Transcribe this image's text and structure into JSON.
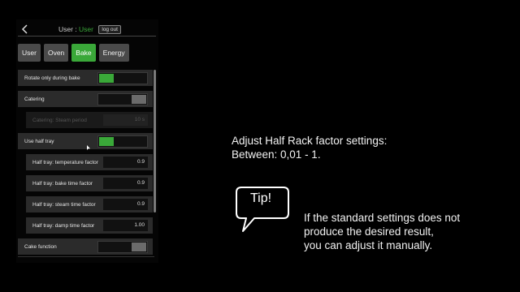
{
  "header": {
    "user_label": "User :",
    "user_name": "User",
    "logout_label": "log out"
  },
  "tabs": [
    {
      "label": "User",
      "active": false
    },
    {
      "label": "Oven",
      "active": false
    },
    {
      "label": "Bake",
      "active": true
    },
    {
      "label": "Energy",
      "active": false
    }
  ],
  "settings": [
    {
      "label": "Rotate only during bake",
      "type": "toggle",
      "state": "on"
    },
    {
      "label": "Catering",
      "type": "toggle",
      "state": "off"
    },
    {
      "label": "Catering: Steam period",
      "type": "value",
      "value": "10 s",
      "disabled": true
    },
    {
      "label": "Use half tray",
      "type": "toggle",
      "state": "on"
    },
    {
      "label": "Half tray: temperature factor",
      "type": "value",
      "value": "0.9"
    },
    {
      "label": "Half tray: bake time factor",
      "type": "value",
      "value": "0.9"
    },
    {
      "label": "Half tray: steam time factor",
      "type": "value",
      "value": "0.9"
    },
    {
      "label": "Half tray: damp time factor",
      "type": "value",
      "value": "1.00"
    },
    {
      "label": "Cake function",
      "type": "toggle",
      "state": "off"
    }
  ],
  "instructions": {
    "line1": "Adjust Half Rack factor settings:",
    "line2": "Between: 0,01 - 1."
  },
  "tip": {
    "label": "Tip!",
    "line1": "If the standard settings does not",
    "line2": "produce the desired result,",
    "line3": "you can adjust it manually."
  },
  "colors": {
    "accent_green": "#3aa839",
    "tab_gray": "#4a4a4a",
    "row_gray": "#2b2b2b",
    "background": "#000000"
  },
  "icons": {
    "back": "chevron-left-icon"
  }
}
